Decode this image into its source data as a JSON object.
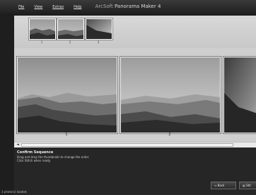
{
  "app": {
    "title_brand": "ArcSoft",
    "title_name": "Panorama Maker 4"
  },
  "menu": [
    {
      "label": "File"
    },
    {
      "label": "View"
    },
    {
      "label": "Extras"
    },
    {
      "label": "Help"
    }
  ],
  "thumbnails": [
    {
      "number": "1"
    },
    {
      "number": "2"
    },
    {
      "number": "3"
    }
  ],
  "sequence": [
    {
      "number": "1"
    },
    {
      "number": "2"
    }
  ],
  "scrollbar": {
    "left_arrow": "◄"
  },
  "panel": {
    "title": "Confirm Sequence",
    "instruction_1": "Drag and drop the thumbnails to change the order.",
    "instruction_2": "Click Stitch when ready.",
    "back_label": "Back",
    "next_label": "Stit"
  },
  "status": "3 photo(s) loaded."
}
